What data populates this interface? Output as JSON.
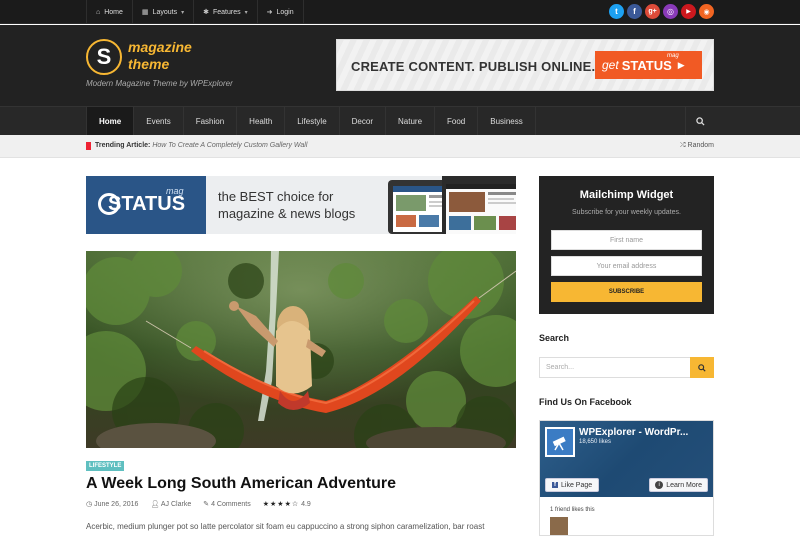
{
  "topbar": {
    "nav": [
      {
        "icon": "home-icon",
        "label": "Home",
        "dropdown": false
      },
      {
        "icon": "layouts-icon",
        "label": "Layouts",
        "dropdown": true
      },
      {
        "icon": "gear-icon",
        "label": "Features",
        "dropdown": true
      },
      {
        "icon": "login-icon",
        "label": "Login",
        "dropdown": false
      }
    ],
    "social": [
      {
        "name": "twitter-icon",
        "glyph": "t",
        "color": "#1da1f2"
      },
      {
        "name": "facebook-icon",
        "glyph": "f",
        "color": "#3b5998"
      },
      {
        "name": "googleplus-icon",
        "glyph": "g+",
        "color": "#dd4b39"
      },
      {
        "name": "instagram-icon",
        "glyph": "◎",
        "color": "#8a3ab9"
      },
      {
        "name": "youtube-icon",
        "glyph": "▶",
        "color": "#cc181e"
      },
      {
        "name": "rss-icon",
        "glyph": "◉",
        "color": "#f26522"
      }
    ]
  },
  "header": {
    "logo_letter": "S",
    "logo_line1": "magazine",
    "logo_line2": "theme",
    "tagline": "Modern Magazine Theme by WPExplorer",
    "banner_text": "CREATE CONTENT. PUBLISH ONLINE.",
    "banner_btn_get": "get",
    "banner_btn_status": "STATUS",
    "banner_btn_mag": "mag"
  },
  "mainnav": {
    "items": [
      "Home",
      "Events",
      "Fashion",
      "Health",
      "Lifestyle",
      "Decor",
      "Nature",
      "Food",
      "Business"
    ],
    "active": "Home"
  },
  "trending": {
    "label": "Trending Article:",
    "article": "How To Create A Completely Custom Gallery Wall",
    "random": "Random"
  },
  "ad": {
    "brand": "STATUS",
    "mag": "mag",
    "line1": "the BEST choice for",
    "line2": "magazine & news blogs"
  },
  "post": {
    "category": "LIFESTYLE",
    "title": "A Week Long South American Adventure",
    "date": "June 26, 2016",
    "author": "AJ Clarke",
    "comments": "4 Comments",
    "rating": "4.9",
    "excerpt": "Acerbic, medium plunger pot so latte percolator sit foam eu cappuccino a strong siphon caramelization, bar roast"
  },
  "sidebar": {
    "mailchimp": {
      "title": "Mailchimp Widget",
      "subtitle": "Subscribe for your weekly updates.",
      "first_name_placeholder": "First name",
      "email_placeholder": "Your email address",
      "button": "SUBSCRIBE"
    },
    "search": {
      "title": "Search",
      "placeholder": "Search..."
    },
    "facebook": {
      "title": "Find Us On Facebook",
      "page_name": "WPExplorer - WordPr...",
      "likes": "18,650 likes",
      "like_btn": "Like Page",
      "learn_btn": "Learn More",
      "friends": "1 friend likes this"
    }
  },
  "colors": {
    "accent": "#f7b733",
    "dark": "#222222",
    "category": "#5fbfc0"
  }
}
